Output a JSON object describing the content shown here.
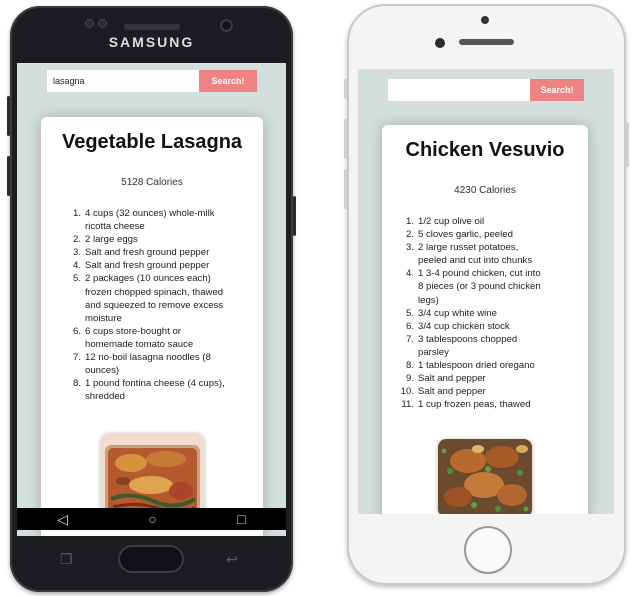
{
  "devices": {
    "samsung": {
      "brand": "SAMSUNG",
      "nav": {
        "back": "◁",
        "home": "○",
        "recents": "□"
      },
      "app": {
        "search": {
          "value": "lasagna",
          "placeholder": "",
          "button": "Search!"
        },
        "recipe": {
          "title": "Vegetable Lasagna",
          "calories": "5128 Calories",
          "ingredients": [
            "4 cups (32 ounces) whole-milk ricotta cheese",
            "2 large eggs",
            "Salt and fresh ground pepper",
            "Salt and fresh ground pepper",
            "2 packages (10 ounces each) frozen chopped spinach, thawed and squeezed to remove excess moisture",
            "6 cups store-bought or homemade tomato sauce",
            "12 no-boil lasagna noodles (8 ounces)",
            "1 pound fontina cheese (4 cups), shredded"
          ]
        }
      }
    },
    "iphone": {
      "app": {
        "search": {
          "value": "",
          "placeholder": "",
          "button": "Search!"
        },
        "recipe": {
          "title": "Chicken Vesuvio",
          "calories": "4230 Calories",
          "ingredients": [
            "1/2 cup olive oil",
            "5 cloves garlic, peeled",
            "2 large russet potatoes, peeled and cut into chunks",
            "1 3-4 pound chicken, cut into 8 pieces (or 3 pound chicken legs)",
            "3/4 cup white wine",
            "3/4 cup chicken stock",
            "3 tablespoons chopped parsley",
            "1 tablespoon dried oregano",
            "Salt and pepper",
            "Salt and pepper",
            "1 cup frozen peas, thawed"
          ]
        }
      }
    }
  },
  "colors": {
    "screen_background": "#d3dfdc",
    "search_button": "#ee8383",
    "card": "#ffffff"
  }
}
